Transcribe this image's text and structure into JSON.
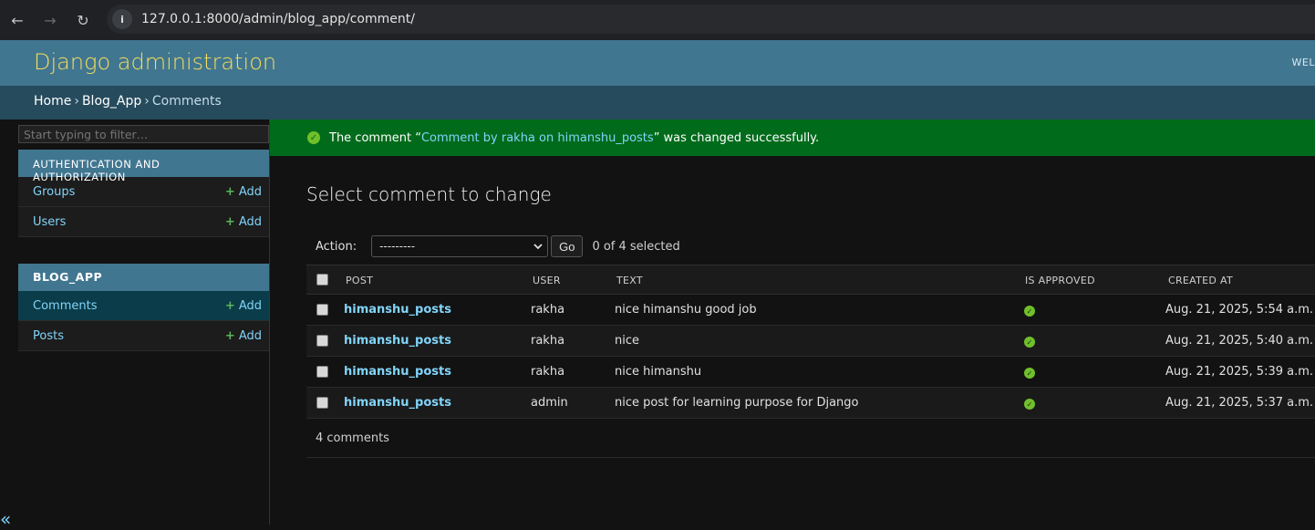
{
  "browser": {
    "url": "127.0.0.1:8000/admin/blog_app/comment/",
    "back_icon": "←",
    "forward_icon": "→",
    "reload_icon": "↻",
    "info_icon": "i"
  },
  "header": {
    "branding": "Django administration",
    "user_tools": "WEL"
  },
  "breadcrumbs": {
    "home": "Home",
    "app": "Blog_App",
    "current": "Comments",
    "separator": "›"
  },
  "sidebar": {
    "filter_placeholder": "Start typing to filter…",
    "auth_caption": "AUTHENTICATION AND AUTHORIZATION",
    "auth_items": [
      {
        "label": "Groups",
        "add": "Add"
      },
      {
        "label": "Users",
        "add": "Add"
      }
    ],
    "blog_caption": "BLOG_APP",
    "blog_items": [
      {
        "label": "Comments",
        "add": "Add"
      },
      {
        "label": "Posts",
        "add": "Add"
      }
    ],
    "plus": "+",
    "collapse_icon": "«"
  },
  "message": {
    "prefix": "The comment “",
    "link": "Comment by rakha on himanshu_posts",
    "suffix": "” was changed successfully.",
    "check": "✓"
  },
  "main": {
    "title": "Select comment to change",
    "action_label": "Action:",
    "action_value": "---------",
    "go_label": "Go",
    "counter": "0 of 4 selected",
    "columns": {
      "post": "POST",
      "user": "USER",
      "text": "TEXT",
      "is_approved": "IS APPROVED",
      "created_at": "CREATED AT"
    },
    "rows": [
      {
        "post": "himanshu_posts",
        "user": "rakha",
        "text": "nice himanshu good job",
        "created": "Aug. 21, 2025, 5:54 a.m."
      },
      {
        "post": "himanshu_posts",
        "user": "rakha",
        "text": "nice",
        "created": "Aug. 21, 2025, 5:40 a.m."
      },
      {
        "post": "himanshu_posts",
        "user": "rakha",
        "text": "nice himanshu",
        "created": "Aug. 21, 2025, 5:39 a.m."
      },
      {
        "post": "himanshu_posts",
        "user": "admin",
        "text": "nice post for learning purpose for Django",
        "created": "Aug. 21, 2025, 5:37 a.m."
      }
    ],
    "paginator": "4 comments"
  },
  "colors": {
    "header": "#417690",
    "breadcrumbs": "#264b5d",
    "branding": "#f5dd5d",
    "success": "#006b1b",
    "link": "#81d4fa",
    "approved": "#70bf2b"
  }
}
